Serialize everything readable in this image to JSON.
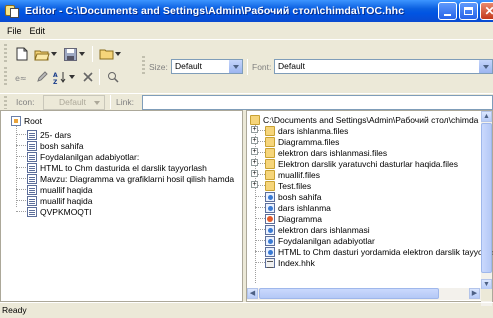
{
  "window": {
    "title": "Editor - C:\\Documents and Settings\\Admin\\Рабочий стол\\chimda\\TOC.hhc"
  },
  "menu": [
    "File",
    "Edit"
  ],
  "toolbar": {
    "size_label": "Size:",
    "size_value": "Default",
    "font_label": "Font:",
    "font_value": "Default",
    "icon_label": "Icon:",
    "icon_value": "Default",
    "link_label": "Link:",
    "link_value": ""
  },
  "left_tree": {
    "root": "Root",
    "items": [
      "25- dars",
      "bosh sahifa",
      "Foydalanilgan adabiyotlar:",
      "HTML to Chm dasturida el darslik tayyorlash",
      "Mavzu: Diagramma va grafiklarni hosil qilish hamda",
      "muallif haqida",
      "muallif haqida",
      "QVPKMOQTI"
    ]
  },
  "right_tree": {
    "root": "C:\\Documents and Settings\\Admin\\Рабочий стол\\chimda",
    "items": [
      {
        "label": "dars ishlanma.files",
        "icon": "folder-icon",
        "expandable": true
      },
      {
        "label": "Diagramma.files",
        "icon": "folder-icon",
        "expandable": true
      },
      {
        "label": "elektron dars ishlanmasi.files",
        "icon": "folder-icon",
        "expandable": true
      },
      {
        "label": "Elektron darslik yaratuvchi dasturlar haqida.files",
        "icon": "folder-icon",
        "expandable": true
      },
      {
        "label": "muallif.files",
        "icon": "folder-icon",
        "expandable": true
      },
      {
        "label": "Test.files",
        "icon": "folder-icon",
        "expandable": true
      },
      {
        "label": "bosh sahifa",
        "icon": "html-file-icon",
        "expandable": false
      },
      {
        "label": "dars ishlanma",
        "icon": "html-file-icon",
        "expandable": false
      },
      {
        "label": "Diagramma",
        "icon": "html-file-icon-red",
        "expandable": false
      },
      {
        "label": "elektron dars ishlanmasi",
        "icon": "html-file-icon",
        "expandable": false
      },
      {
        "label": "Foydalanilgan adabiyotlar",
        "icon": "html-file-icon",
        "expandable": false
      },
      {
        "label": "HTML to Chm dasturi yordamida elektron darslik tayyorlash",
        "icon": "html-file-icon",
        "expandable": false
      },
      {
        "label": "Index.hhk",
        "icon": "index-file-icon",
        "expandable": false
      }
    ]
  },
  "status": {
    "text": "Ready"
  },
  "colors": {
    "title_bar": "#0054e3",
    "chrome": "#ece9d8",
    "close_button": "#c4391b"
  }
}
